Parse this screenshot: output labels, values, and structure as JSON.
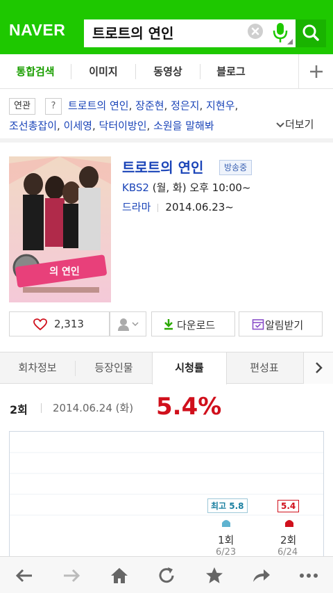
{
  "header": {
    "logo": "NAVER",
    "search_value": "트로트의 연인"
  },
  "tabs": [
    {
      "label": "통합검색",
      "active": true
    },
    {
      "label": "이미지"
    },
    {
      "label": "동영상"
    },
    {
      "label": "블로그"
    }
  ],
  "related": {
    "badge": "연관",
    "help": "?",
    "line1": [
      "트로트의 연인",
      "장준현",
      "정은지",
      "지현우"
    ],
    "line2": [
      "조선총잡이",
      "이세영",
      "닥터이방인",
      "소원을 말해봐"
    ],
    "more_label": "더보기"
  },
  "program": {
    "title": "트로트의 연인",
    "status": "방송중",
    "channel": "KBS2",
    "schedule": "(월, 화) 오후 10:00~",
    "genre": "드라마",
    "start_date": "2014.06.23~",
    "poster_text": "의 연인"
  },
  "actions": {
    "like_count": "2,313",
    "download_label": "다운로드",
    "alarm_label": "알림받기"
  },
  "subtabs": [
    {
      "label": "회차정보"
    },
    {
      "label": "등장인물"
    },
    {
      "label": "시청률",
      "active": true
    },
    {
      "label": "편성표"
    }
  ],
  "rating": {
    "episode": "2회",
    "date": "2014.06.24 (화)",
    "value": "5.4%",
    "chart": {
      "max_label": "최고 5.8",
      "current_label": "5.4",
      "episodes": [
        {
          "ep": "1회",
          "date": "6/23"
        },
        {
          "ep": "2회",
          "date": "6/24"
        }
      ]
    }
  },
  "colors": {
    "brand_green": "#1ec800",
    "link_blue": "#1a44b8",
    "rating_red": "#d0101c"
  }
}
